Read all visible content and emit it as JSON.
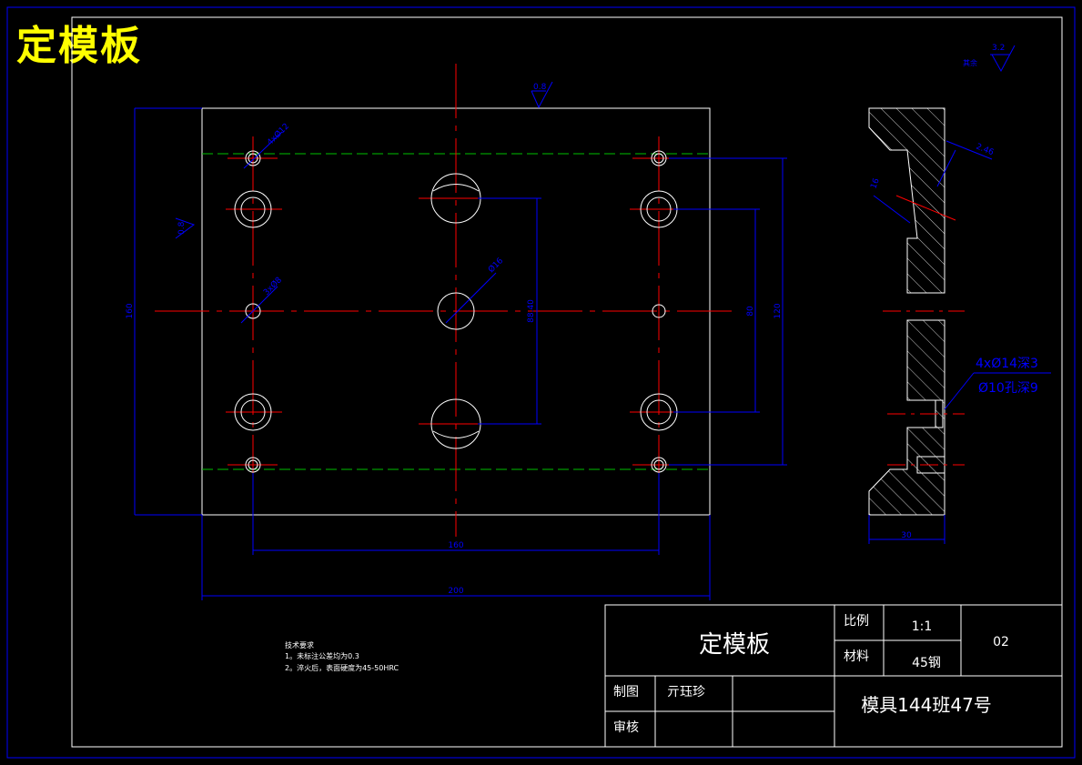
{
  "header": {
    "title": "定模板"
  },
  "surface": {
    "top_roughness": "3.2",
    "top_roughness_label": "其余"
  },
  "front_view": {
    "roughness_top": "0.8",
    "roughness_left": "0.8",
    "dims": {
      "overall_width": "200",
      "hole_spacing_x": "160",
      "overall_height": "160",
      "hole_spacing_y_outer": "120",
      "hole_spacing_y_inner": "80",
      "hole_spacing_y_mid": "88.40",
      "center_hole": "Ø16",
      "small_hole": "3xØ8",
      "corner_hole": "4xØ12"
    }
  },
  "side_view": {
    "dims": {
      "thickness": "30",
      "angle_len": "2.46",
      "angle_side": "16"
    },
    "callout_line1": "4xØ14深3",
    "callout_line2": "Ø10孔深9"
  },
  "notes": {
    "heading": "技术要求",
    "line1": "1。未标注公差均为0.3",
    "line2": "2。淬火后，表面硬度为45-50HRC"
  },
  "title_block": {
    "part_name": "定模板",
    "scale_label": "比例",
    "scale_value": "1:1",
    "material_label": "材料",
    "material_value": "45钢",
    "drawing_no": "02",
    "drawn_label": "制图",
    "drawn_by": "亓珏珍",
    "check_label": "审核",
    "class_info": "模具144班47号"
  },
  "colors": {
    "background": "#000000",
    "border": "#0000ff",
    "outline": "#ffffff",
    "center_line": "#ff0000",
    "hidden_line": "#00c000",
    "dimension": "#0000ff",
    "title_text": "#ffff00"
  }
}
